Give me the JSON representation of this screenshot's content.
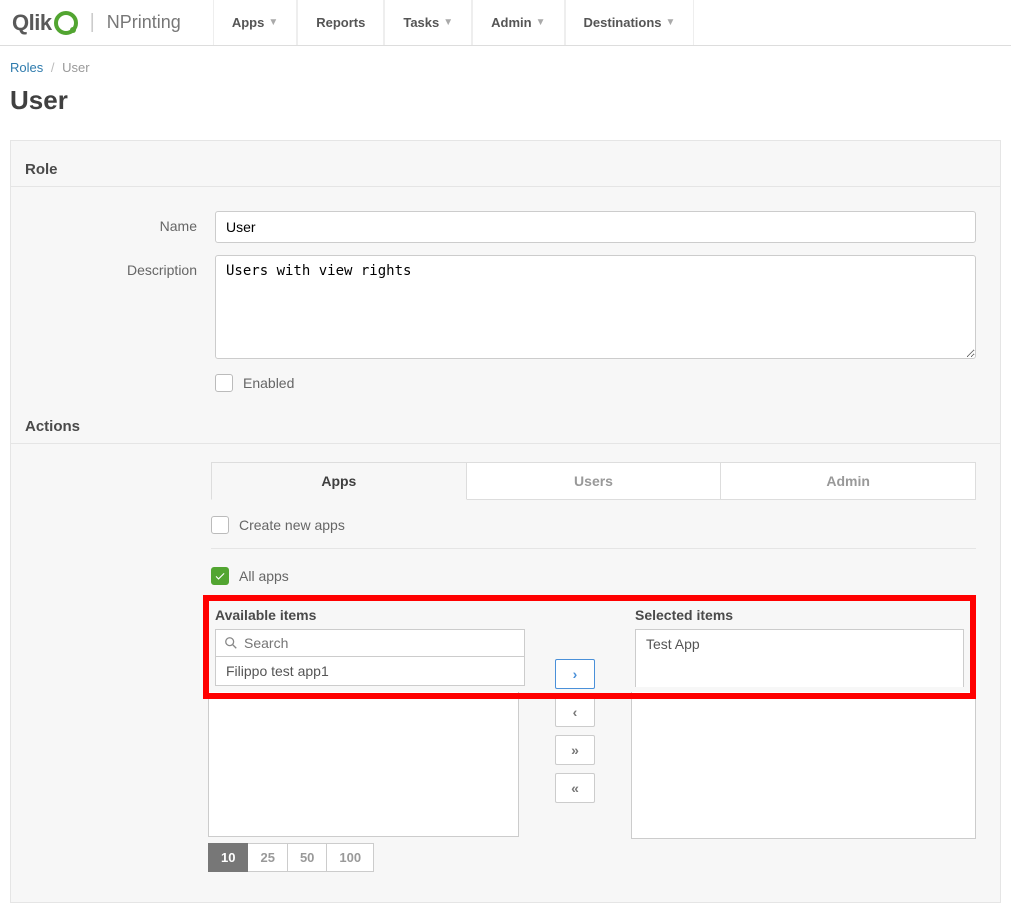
{
  "brand": {
    "qlik": "Qlik",
    "product": "NPrinting"
  },
  "nav": {
    "apps": "Apps",
    "reports": "Reports",
    "tasks": "Tasks",
    "admin": "Admin",
    "destinations": "Destinations"
  },
  "breadcrumb": {
    "roles": "Roles",
    "current": "User"
  },
  "page": {
    "title": "User"
  },
  "role": {
    "section_label": "Role",
    "name_label": "Name",
    "name_value": "User",
    "description_label": "Description",
    "description_value": "Users with view rights",
    "enabled_label": "Enabled",
    "enabled_checked": false
  },
  "actions": {
    "section_label": "Actions",
    "tabs": {
      "apps": "Apps",
      "users": "Users",
      "admin": "Admin"
    },
    "create_new_apps_label": "Create new apps",
    "create_new_apps_checked": false,
    "all_apps_label": "All apps",
    "all_apps_checked": true
  },
  "shuttle": {
    "available_title": "Available items",
    "selected_title": "Selected items",
    "search_placeholder": "Search",
    "available_items": [
      "Filippo test app1"
    ],
    "selected_items": [
      "Test App"
    ]
  },
  "pager": {
    "options": [
      "10",
      "25",
      "50",
      "100"
    ],
    "active": "10"
  }
}
